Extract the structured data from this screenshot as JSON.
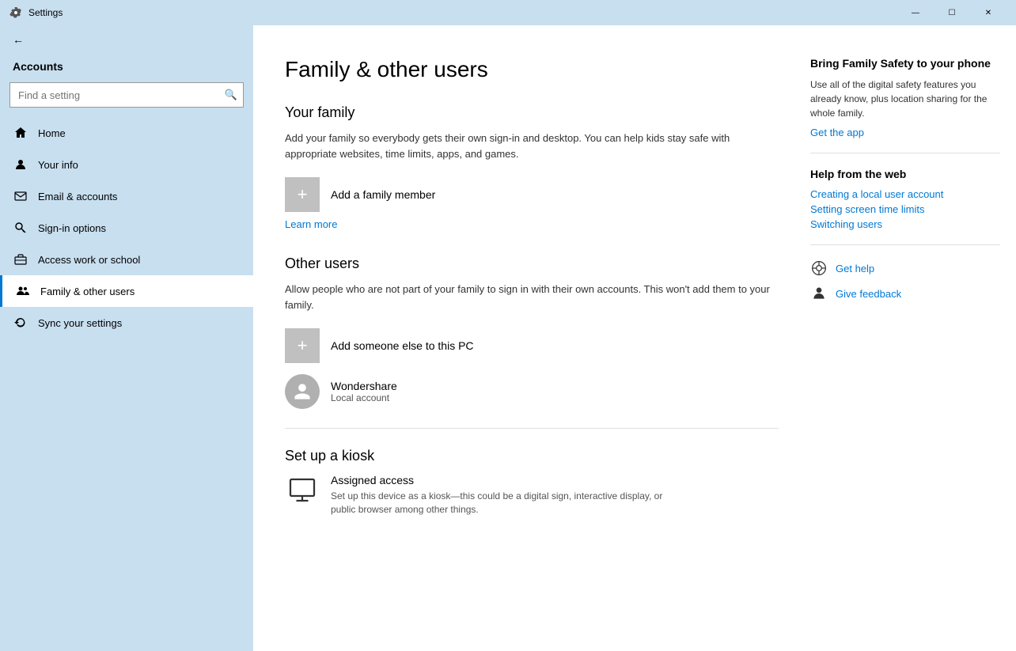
{
  "titlebar": {
    "title": "Settings",
    "minimize": "—",
    "maximize": "☐",
    "close": "✕"
  },
  "sidebar": {
    "back_label": "Back",
    "section_label": "Accounts",
    "search_placeholder": "Find a setting",
    "items": [
      {
        "id": "home",
        "label": "Home",
        "icon": "⌂"
      },
      {
        "id": "your-info",
        "label": "Your info",
        "icon": "person"
      },
      {
        "id": "email-accounts",
        "label": "Email & accounts",
        "icon": "email"
      },
      {
        "id": "sign-in-options",
        "label": "Sign-in options",
        "icon": "key"
      },
      {
        "id": "access-work",
        "label": "Access work or school",
        "icon": "briefcase"
      },
      {
        "id": "family-users",
        "label": "Family & other users",
        "icon": "family",
        "active": true
      },
      {
        "id": "sync-settings",
        "label": "Sync your settings",
        "icon": "sync"
      }
    ]
  },
  "page": {
    "title": "Family & other users",
    "your_family": {
      "section_title": "Your family",
      "description": "Add your family so everybody gets their own sign-in and desktop. You can help kids stay safe with appropriate websites, time limits, apps, and games.",
      "add_label": "Add a family member",
      "learn_more": "Learn more"
    },
    "other_users": {
      "section_title": "Other users",
      "description": "Allow people who are not part of your family to sign in with their own accounts. This won't add them to your family.",
      "add_label": "Add someone else to this PC",
      "users": [
        {
          "name": "Wondershare",
          "sub": "Local account"
        }
      ]
    },
    "kiosk": {
      "section_title": "Set up a kiosk",
      "title": "Assigned access",
      "description": "Set up this device as a kiosk—this could be a digital sign, interactive display, or public browser among other things."
    }
  },
  "right_panel": {
    "promo_title": "Bring Family Safety to your phone",
    "promo_desc": "Use all of the digital safety features you already know, plus location sharing for the whole family.",
    "promo_link": "Get the app",
    "help_title": "Help from the web",
    "help_links": [
      "Creating a local user account",
      "Setting screen time limits",
      "Switching users"
    ],
    "get_help": "Get help",
    "give_feedback": "Give feedback"
  }
}
